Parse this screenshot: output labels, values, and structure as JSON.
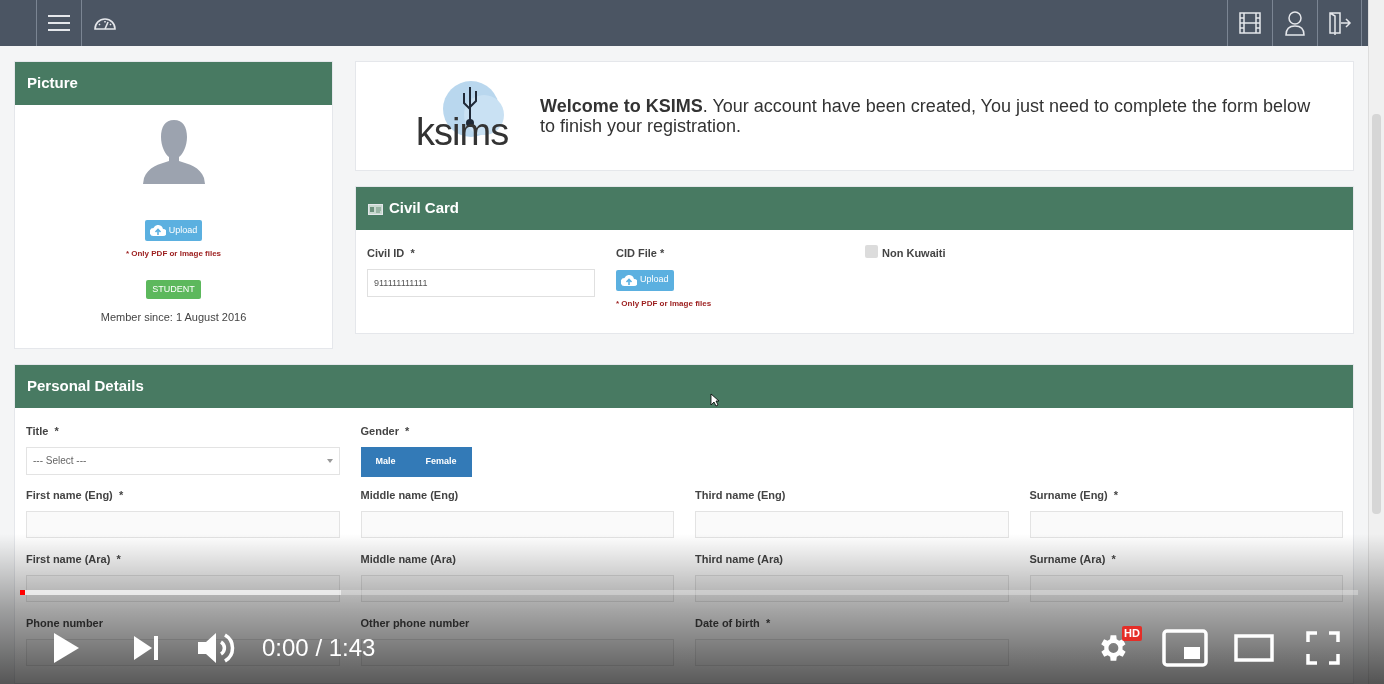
{
  "picture_panel": {
    "title": "Picture",
    "upload_button": "Upload",
    "note": "* Only PDF or Image files",
    "role_badge": "STUDENT",
    "member_since": "Member since: 1 August 2016"
  },
  "welcome": {
    "logo_text": "ksims",
    "message": "**Welcome to KSIMS**. Your account have been created, You just need to complete the form below to finish your registration."
  },
  "civil_card": {
    "title": "Civil Card",
    "civil_id": {
      "label": "Civil ID  *",
      "value": "911111111111"
    },
    "cid_file": {
      "label": "CID File *",
      "upload_button": "Upload",
      "note": "* Only PDF or Image files"
    },
    "non_kuwaiti": {
      "label": "Non Kuwaiti",
      "checked": false
    }
  },
  "personal_details": {
    "title": "Personal Details",
    "fields": [
      {
        "kind": "select",
        "label": "Title  *",
        "placeholder": "--- Select ---"
      },
      {
        "kind": "toggle",
        "label": "Gender  *",
        "options": [
          {
            "label": "Male",
            "selected": false
          },
          {
            "label": "Female",
            "selected": false
          }
        ]
      },
      {
        "kind": "blank"
      },
      {
        "kind": "blank"
      },
      {
        "kind": "text",
        "label": "First name (Eng)  *"
      },
      {
        "kind": "text",
        "label": "Middle name (Eng)"
      },
      {
        "kind": "text",
        "label": "Third name (Eng)"
      },
      {
        "kind": "text",
        "label": "Surname (Eng)  *"
      },
      {
        "kind": "text",
        "label": "First name (Ara)  *"
      },
      {
        "kind": "text",
        "label": "Middle name (Ara)"
      },
      {
        "kind": "text",
        "label": "Third name (Ara)"
      },
      {
        "kind": "text",
        "label": "Surname (Ara)  *"
      },
      {
        "kind": "text",
        "label": "Phone number"
      },
      {
        "kind": "text",
        "label": "Other phone number"
      },
      {
        "kind": "text",
        "label": "Date of birth  *"
      }
    ]
  },
  "video_player": {
    "buffered": {
      "level": 0.24
    },
    "played": {
      "level": 0.004
    },
    "time": "0:00 / 1:43",
    "quality_badge": "HD"
  }
}
